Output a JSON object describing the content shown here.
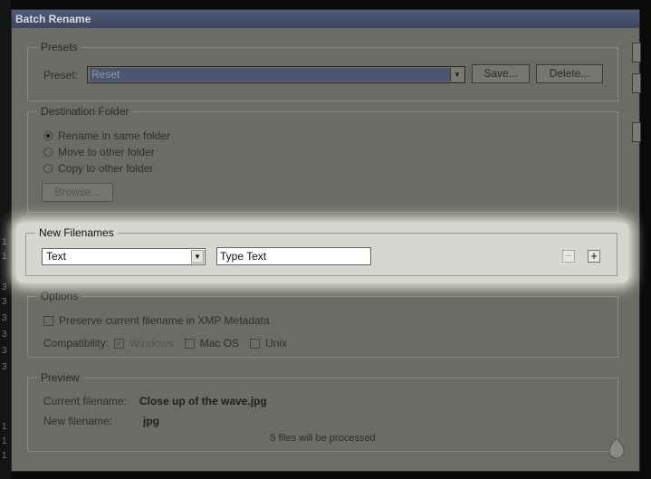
{
  "window": {
    "title": "Batch Rename"
  },
  "presets": {
    "legend": "Presets",
    "label": "Preset:",
    "value": "Reset",
    "save_label": "Save...",
    "delete_label": "Delete..."
  },
  "destination": {
    "legend": "Destination Folder",
    "options": [
      "Rename in same folder",
      "Move to other folder",
      "Copy to other folder"
    ],
    "selected_index": 0,
    "browse_label": "Browse..."
  },
  "new_filenames": {
    "legend": "New Filenames",
    "type_value": "Text",
    "text_value": "Type Text",
    "remove_symbol": "−",
    "add_symbol": "+"
  },
  "options": {
    "legend": "Options",
    "preserve_label": "Preserve current filename in XMP Metadata",
    "compat_label": "Compatibility:",
    "compat_windows": "Windows",
    "compat_mac": "Mac OS",
    "compat_unix": "Unix"
  },
  "preview": {
    "legend": "Preview",
    "current_label": "Current filename:",
    "current_value": "Close up of the wave.jpg",
    "new_label": "New filename:",
    "new_value": "jpg",
    "files_processed": "5 files will be processed"
  },
  "background_numbers": [
    "1",
    "1",
    "3",
    "3",
    "3",
    "3",
    "3",
    "3",
    "1",
    "1",
    "1"
  ],
  "colors": {
    "highlight_panel": "#d8d6d0",
    "dim_overlay": "#6c6b65",
    "titlebar": "#3d4760"
  }
}
